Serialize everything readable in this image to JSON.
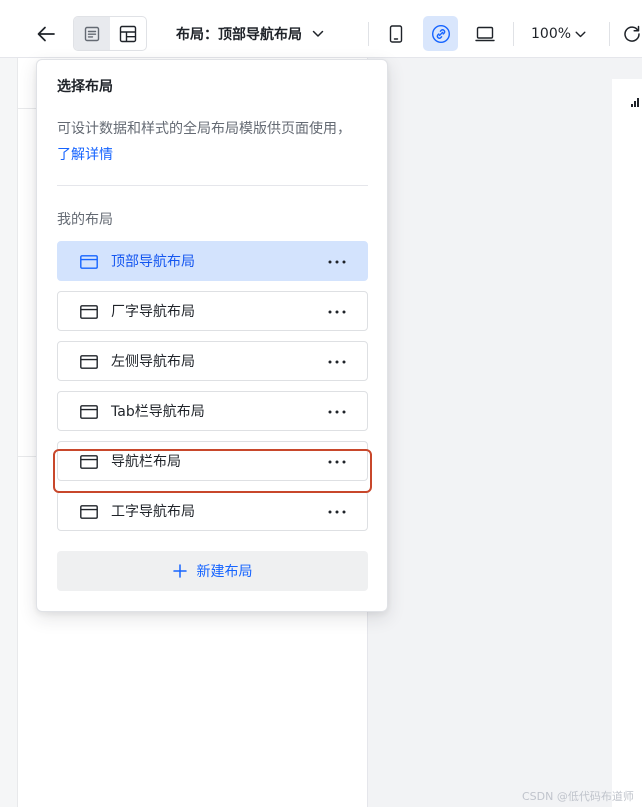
{
  "topbar": {
    "title": "布局：顶部导航布局",
    "zoom": "100%"
  },
  "popover": {
    "title": "选择布局",
    "description": "可设计数据和样式的全局布局模版供页面使用，",
    "learn_more": "了解详情",
    "section_label": "我的布局",
    "layouts": [
      {
        "label": "顶部导航布局",
        "selected": true
      },
      {
        "label": "厂字导航布局",
        "selected": false
      },
      {
        "label": "左侧导航布局",
        "selected": false
      },
      {
        "label": "Tab栏导航布局",
        "selected": false,
        "highlighted": true
      },
      {
        "label": "导航栏布局",
        "selected": false
      },
      {
        "label": "工字导航布局",
        "selected": false
      }
    ],
    "new_layout_label": "新建布局"
  },
  "colors": {
    "accent": "#1664ff",
    "selected_bg": "#d3e3fd",
    "highlight_ring": "#c8472b"
  },
  "icons": {
    "back": "arrow-left-icon",
    "page": "page-list-icon",
    "layout": "layout-grid-icon",
    "mobile": "mobile-icon",
    "link": "link-icon",
    "desktop": "desktop-icon",
    "refresh": "refresh-icon",
    "item": "window-layout-icon",
    "more": "more-horizontal-icon",
    "add": "plus-icon"
  },
  "watermark": "CSDN @低代码布道师"
}
